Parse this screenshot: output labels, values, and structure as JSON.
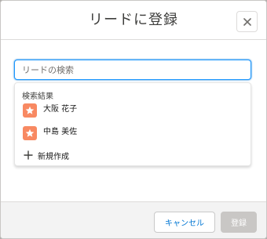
{
  "modal": {
    "title": "リードに登録",
    "close_icon": "close-icon"
  },
  "search": {
    "value": "",
    "placeholder": "リードの検索"
  },
  "results": {
    "heading": "検索結果",
    "items": [
      {
        "name": "大阪 花子",
        "icon": "lead-star-icon"
      },
      {
        "name": "中島 美佐",
        "icon": "lead-star-icon"
      }
    ],
    "new_label": "新規作成",
    "new_icon": "plus-icon"
  },
  "footer": {
    "cancel_label": "キャンセル",
    "save_label": "登録"
  },
  "colors": {
    "accent": "#0176d3",
    "lead_icon": "#f88962",
    "disabled": "#c9c7c5"
  }
}
